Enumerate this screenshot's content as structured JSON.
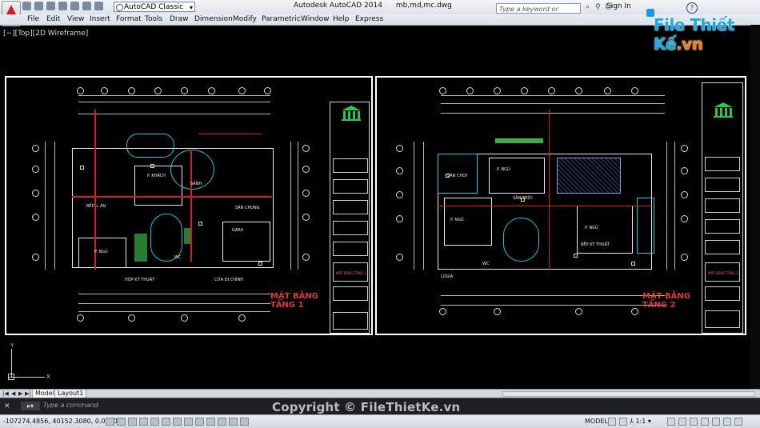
{
  "titlebar": {
    "workspace": "AutoCAD Classic",
    "app_name": "Autodesk AutoCAD 2014",
    "file_name": "mb,md,mc.dwg",
    "search_placeholder": "Type a keyword or phrase",
    "signin": "Sign In",
    "help": "?"
  },
  "menu": [
    "File",
    "Edit",
    "View",
    "Insert",
    "Format",
    "Tools",
    "Draw",
    "Dimension",
    "Modify",
    "Parametric",
    "Window",
    "Help",
    "Express"
  ],
  "watermark_logo": {
    "text_a": "File",
    "text_b": "Thiết Kế",
    "text_c": ".vn"
  },
  "viewport_controls": "[−][Top][2D Wireframe]",
  "sheet1": {
    "title": "MẶT BẰNG TẦNG 1",
    "titleblock_name": "MẶT BẰNG TẦNG 1"
  },
  "sheet2": {
    "title": "MẶT BẰNG TẦNG 2",
    "titleblock_name": "MẶT BẰNG TẦNG 2"
  },
  "ucs": {
    "x": "X",
    "y": "Y"
  },
  "tabs": {
    "model": "Model",
    "layout": "Layout1"
  },
  "command": {
    "placeholder": "Type a command"
  },
  "copyright": "Copyright © FileThietKe.vn",
  "status": {
    "coordinates": "-107274.4856, 40152.3080, 0.0000",
    "space": "MODEL",
    "scale": "1:1"
  },
  "colors": {
    "canvas": "#000000",
    "sheet_title": "#e0383b",
    "logo_blue": "#1da6e8",
    "logo_orange": "#f07a1c"
  }
}
